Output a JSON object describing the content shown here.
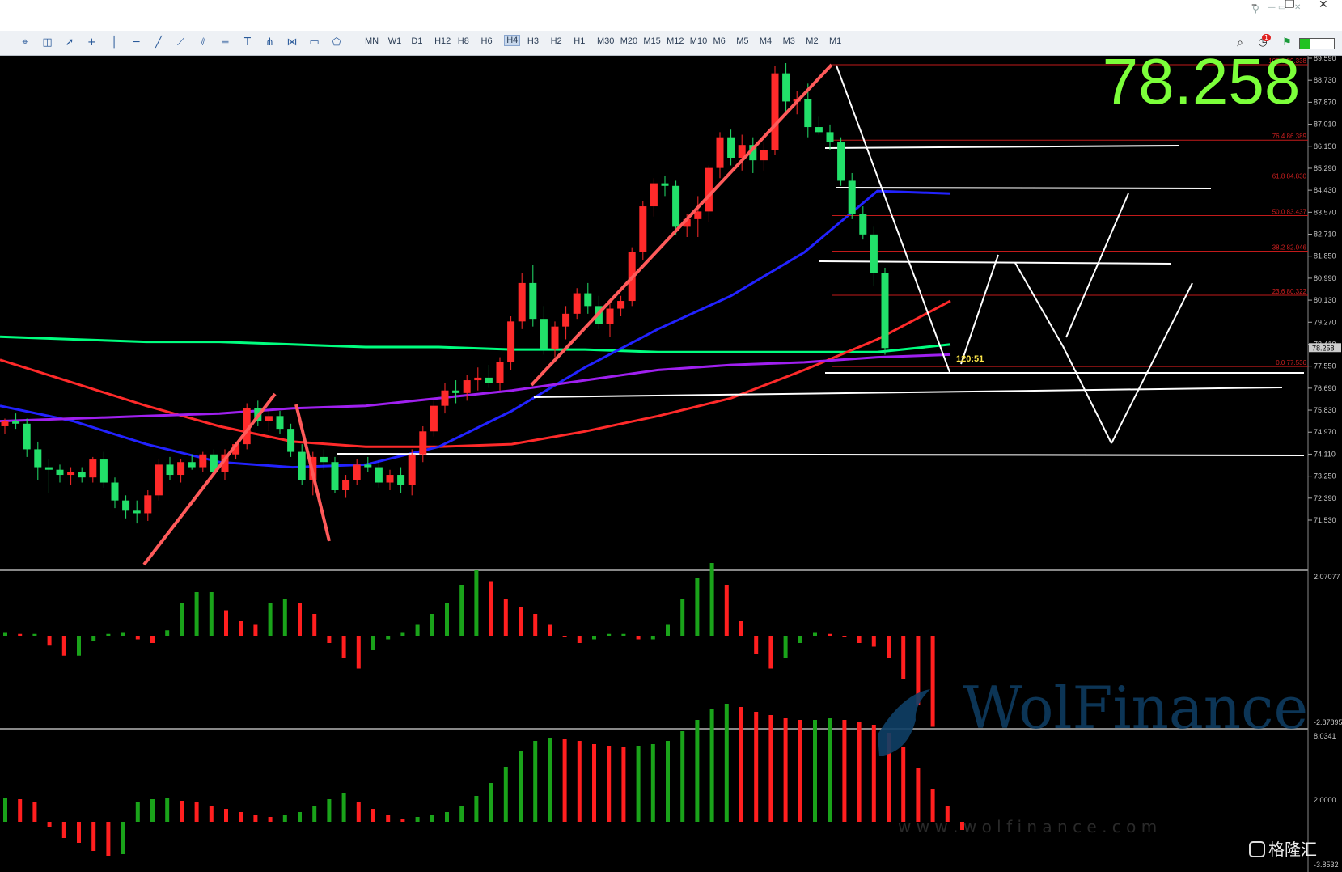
{
  "window": {
    "minimize_icon": "minimize-icon",
    "restore_icon": "restore-icon",
    "close_icon": "close-icon"
  },
  "toolbar": {
    "timeframes": [
      "MN",
      "W1",
      "D1",
      "H12",
      "H8",
      "H6",
      "H4",
      "H3",
      "H2",
      "H1",
      "M30",
      "M20",
      "M15",
      "M12",
      "M10",
      "M6",
      "M5",
      "M4",
      "M3",
      "M2",
      "M1"
    ],
    "active_timeframe": "H4",
    "notification_count": "1",
    "tools": [
      "crosshair-icon",
      "screenshot-icon",
      "cursor-icon",
      "cross-icon",
      "vertical-line-icon",
      "horizontal-line-icon",
      "trend-line-icon",
      "ray-icon",
      "channel-icon",
      "fibonacci-icon",
      "text-icon",
      "pitchfork-icon",
      "gann-icon",
      "rectangle-icon",
      "shapes-icon"
    ]
  },
  "price_display": "78.258",
  "countdown": "120:51",
  "watermark": {
    "brand": "WolFinance",
    "url": "w w w . w o l f i n a n c e . c o m"
  },
  "corner_logo": "格隆汇",
  "chart_data": {
    "type": "candlestick",
    "timeframe": "H4",
    "price_axis_ticks": [
      "89.590",
      "88.730",
      "87.870",
      "87.010",
      "86.150",
      "85.290",
      "84.430",
      "83.570",
      "82.710",
      "81.850",
      "80.990",
      "80.130",
      "79.270",
      "78.410",
      "77.550",
      "76.690",
      "75.830",
      "74.970",
      "74.110",
      "73.250",
      "72.390",
      "71.530"
    ],
    "current_price_label": "78.258",
    "fibonacci_levels": [
      {
        "label": "100.0 89.338",
        "price": 89.338
      },
      {
        "label": "76.4 86.389",
        "price": 86.389
      },
      {
        "label": "61.8 84.830",
        "price": 84.83
      },
      {
        "label": "50.0 83.437",
        "price": 83.437
      },
      {
        "label": "38.2 82.046",
        "price": 82.046
      },
      {
        "label": "23.6 80.322",
        "price": 80.322
      },
      {
        "label": "0.0 77.536",
        "price": 77.536
      }
    ],
    "candles": [
      [
        75.2,
        75.5,
        74.9,
        75.4
      ],
      [
        75.4,
        75.7,
        75.1,
        75.3
      ],
      [
        75.3,
        75.5,
        74.0,
        74.3
      ],
      [
        74.3,
        74.6,
        73.1,
        73.6
      ],
      [
        73.6,
        73.9,
        72.6,
        73.5
      ],
      [
        73.5,
        73.7,
        73.0,
        73.3
      ],
      [
        73.3,
        73.6,
        72.9,
        73.4
      ],
      [
        73.4,
        73.6,
        73.0,
        73.2
      ],
      [
        73.2,
        74.0,
        73.0,
        73.9
      ],
      [
        73.9,
        74.2,
        72.8,
        73.0
      ],
      [
        73.0,
        73.2,
        72.0,
        72.3
      ],
      [
        72.3,
        72.5,
        71.6,
        71.9
      ],
      [
        71.9,
        72.3,
        71.4,
        71.8
      ],
      [
        71.8,
        72.7,
        71.5,
        72.5
      ],
      [
        72.5,
        73.9,
        72.3,
        73.7
      ],
      [
        73.7,
        74.0,
        73.1,
        73.3
      ],
      [
        73.3,
        73.9,
        73.0,
        73.8
      ],
      [
        73.8,
        74.1,
        73.5,
        73.6
      ],
      [
        73.6,
        74.2,
        73.4,
        74.1
      ],
      [
        74.1,
        74.3,
        73.3,
        73.4
      ],
      [
        73.4,
        74.3,
        73.1,
        74.1
      ],
      [
        74.1,
        74.6,
        73.9,
        74.5
      ],
      [
        74.5,
        76.1,
        74.3,
        75.9
      ],
      [
        75.9,
        76.2,
        75.2,
        75.4
      ],
      [
        75.4,
        75.8,
        75.0,
        75.6
      ],
      [
        75.6,
        75.8,
        74.9,
        75.1
      ],
      [
        75.1,
        75.3,
        74.0,
        74.2
      ],
      [
        74.2,
        74.5,
        72.9,
        73.1
      ],
      [
        73.1,
        74.2,
        72.5,
        74.0
      ],
      [
        74.0,
        74.3,
        73.5,
        73.8
      ],
      [
        73.8,
        74.0,
        72.6,
        72.7
      ],
      [
        72.7,
        73.3,
        72.4,
        73.1
      ],
      [
        73.1,
        73.9,
        72.9,
        73.7
      ],
      [
        73.7,
        74.0,
        73.4,
        73.6
      ],
      [
        73.6,
        73.9,
        72.8,
        73.0
      ],
      [
        73.0,
        73.5,
        72.7,
        73.3
      ],
      [
        73.3,
        73.6,
        72.6,
        72.9
      ],
      [
        72.9,
        74.3,
        72.5,
        74.1
      ],
      [
        74.1,
        75.2,
        73.8,
        75.0
      ],
      [
        75.0,
        76.2,
        74.8,
        76.0
      ],
      [
        76.0,
        76.9,
        75.7,
        76.6
      ],
      [
        76.6,
        77.0,
        76.1,
        76.5
      ],
      [
        76.5,
        77.2,
        76.2,
        77.0
      ],
      [
        77.0,
        77.5,
        76.6,
        77.1
      ],
      [
        77.1,
        77.6,
        76.7,
        76.9
      ],
      [
        76.9,
        77.9,
        76.6,
        77.7
      ],
      [
        77.7,
        79.5,
        77.4,
        79.3
      ],
      [
        79.3,
        81.2,
        79.0,
        80.8
      ],
      [
        80.8,
        81.5,
        79.1,
        79.4
      ],
      [
        79.4,
        79.9,
        78.0,
        78.2
      ],
      [
        78.2,
        79.3,
        77.9,
        79.1
      ],
      [
        79.1,
        79.9,
        78.6,
        79.6
      ],
      [
        79.6,
        80.6,
        79.4,
        80.4
      ],
      [
        80.4,
        80.8,
        79.6,
        79.9
      ],
      [
        79.9,
        80.3,
        79.0,
        79.2
      ],
      [
        79.2,
        80.1,
        78.7,
        79.8
      ],
      [
        79.8,
        80.3,
        79.5,
        80.1
      ],
      [
        80.1,
        82.2,
        79.9,
        82.0
      ],
      [
        82.0,
        84.0,
        81.7,
        83.8
      ],
      [
        83.8,
        84.9,
        83.4,
        84.7
      ],
      [
        84.7,
        85.0,
        84.2,
        84.6
      ],
      [
        84.6,
        84.8,
        82.7,
        83.0
      ],
      [
        83.0,
        83.5,
        82.6,
        83.3
      ],
      [
        83.3,
        84.2,
        82.6,
        83.6
      ],
      [
        83.6,
        85.4,
        83.2,
        85.3
      ],
      [
        85.3,
        86.7,
        84.9,
        86.5
      ],
      [
        86.5,
        86.8,
        85.4,
        85.7
      ],
      [
        85.7,
        86.6,
        85.2,
        86.2
      ],
      [
        86.2,
        86.5,
        85.1,
        85.6
      ],
      [
        85.6,
        86.3,
        85.2,
        86.0
      ],
      [
        86.0,
        89.3,
        85.8,
        89.0
      ],
      [
        89.0,
        89.4,
        87.5,
        87.9
      ],
      [
        87.9,
        88.3,
        87.4,
        88.0
      ],
      [
        88.0,
        88.6,
        86.5,
        86.9
      ],
      [
        86.9,
        87.3,
        86.6,
        86.7
      ],
      [
        86.7,
        87.0,
        86.0,
        86.3
      ],
      [
        86.3,
        86.5,
        84.6,
        84.8
      ],
      [
        84.8,
        85.1,
        83.3,
        83.5
      ],
      [
        83.5,
        83.8,
        82.5,
        82.7
      ],
      [
        82.7,
        83.0,
        80.7,
        81.2
      ],
      [
        81.2,
        81.4,
        78.0,
        78.258
      ]
    ],
    "moving_averages": [
      {
        "color": "#00ff7f",
        "values": [
          78.7,
          78.6,
          78.5,
          78.5,
          78.4,
          78.3,
          78.3,
          78.2,
          78.2,
          78.1,
          78.1,
          78.1,
          78.1,
          78.4
        ]
      },
      {
        "color": "#ff2a2a",
        "values": [
          77.8,
          76.9,
          76.0,
          75.2,
          74.6,
          74.4,
          74.4,
          74.5,
          75.0,
          75.6,
          76.3,
          77.4,
          78.6,
          80.1
        ]
      },
      {
        "color": "#2222ff",
        "values": [
          76.0,
          75.4,
          74.5,
          73.8,
          73.6,
          73.7,
          74.4,
          75.8,
          77.5,
          79.0,
          80.3,
          82.0,
          84.4,
          84.3
        ]
      },
      {
        "color": "#a020f0",
        "values": [
          75.4,
          75.5,
          75.6,
          75.7,
          75.9,
          76.0,
          76.3,
          76.6,
          77.0,
          77.4,
          77.6,
          77.7,
          77.9,
          78.0
        ]
      }
    ],
    "histogram1": {
      "axis_ticks": [
        "2.07077",
        "-2.87895"
      ],
      "values": [
        0.1,
        0.05,
        0.05,
        -0.25,
        -0.55,
        -0.55,
        -0.15,
        0.05,
        0.1,
        -0.1,
        -0.2,
        0.15,
        0.9,
        1.2,
        1.2,
        0.7,
        0.4,
        0.3,
        0.9,
        1.0,
        0.9,
        0.6,
        -0.2,
        -0.6,
        -0.9,
        -0.4,
        -0.1,
        0.1,
        0.3,
        0.6,
        0.9,
        1.4,
        1.8,
        1.5,
        1.0,
        0.8,
        0.6,
        0.3,
        0.0,
        -0.2,
        -0.1,
        0.05,
        0.05,
        -0.1,
        -0.1,
        0.3,
        1.0,
        1.6,
        2.0,
        1.4,
        0.4,
        -0.5,
        -0.9,
        -0.6,
        -0.2,
        0.1,
        0.05,
        0.0,
        -0.2,
        -0.3,
        -0.6,
        -1.2,
        -1.9,
        -2.5
      ]
    },
    "histogram2": {
      "axis_ticks": [
        "8.0341",
        "2.0000",
        "-3.8532"
      ],
      "values": [
        1.5,
        1.4,
        1.2,
        -0.3,
        -1.0,
        -1.3,
        -1.8,
        -2.1,
        -2.0,
        1.2,
        1.4,
        1.5,
        1.3,
        1.2,
        1.0,
        0.8,
        0.6,
        0.4,
        0.3,
        0.4,
        0.6,
        1.0,
        1.4,
        1.8,
        1.2,
        0.8,
        0.4,
        0.2,
        0.3,
        0.4,
        0.6,
        1.0,
        1.6,
        2.4,
        3.4,
        4.4,
        5.0,
        5.2,
        5.1,
        5.0,
        4.8,
        4.7,
        4.6,
        4.7,
        4.8,
        5.0,
        5.6,
        6.3,
        7.0,
        7.3,
        7.1,
        6.8,
        6.6,
        6.4,
        6.3,
        6.3,
        6.4,
        6.3,
        6.2,
        6.0,
        5.5,
        4.6,
        3.3,
        2.0,
        1.0,
        -0.5
      ]
    }
  }
}
